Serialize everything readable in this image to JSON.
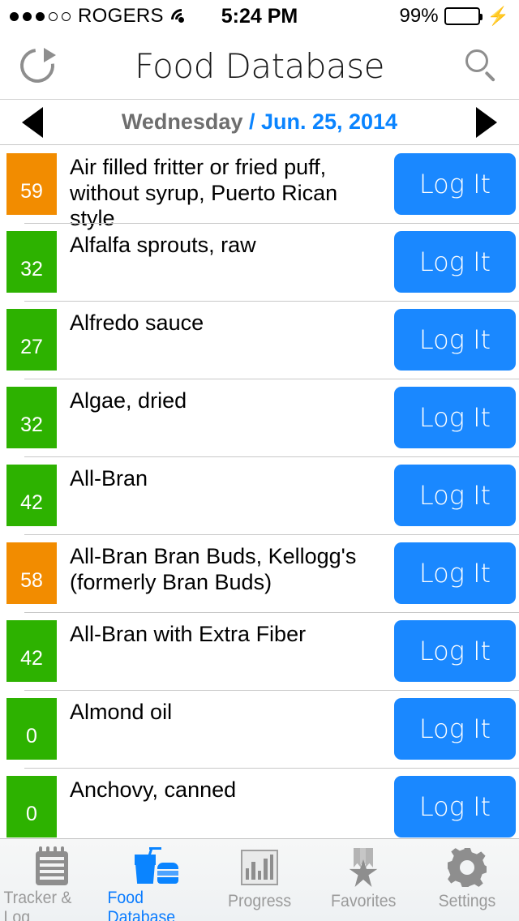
{
  "statusbar": {
    "carrier": "ROGERS",
    "signal_dots_filled": 3,
    "signal_dots_total": 5,
    "wifi_icon": "wifi-icon",
    "time": "5:24 PM",
    "battery_percent": "99%",
    "battery_color": "#4CDA64",
    "charging_icon": "lightning-bolt-icon"
  },
  "navbar": {
    "refresh_icon": "refresh-icon",
    "title": "Food Database",
    "search_icon": "search-icon"
  },
  "datebar": {
    "prev_icon": "triangle-left-icon",
    "next_icon": "triangle-right-icon",
    "day": "Wednesday",
    "date": " / Jun. 25, 2014",
    "day_color": "#6e6e6e",
    "date_color": "#0a84ff"
  },
  "colors": {
    "score_orange": "#F28C00",
    "score_green": "#2DB200",
    "button_blue": "#1A88FF",
    "tab_active": "#0A7CFF",
    "tab_inactive": "#9A9A9A"
  },
  "list": {
    "log_button_label": "Log It",
    "rows": [
      {
        "score": "59",
        "score_color": "orange",
        "name": "Air filled fritter or fried puff, without syrup, Puerto Rican style"
      },
      {
        "score": "32",
        "score_color": "green",
        "name": "Alfalfa sprouts, raw"
      },
      {
        "score": "27",
        "score_color": "green",
        "name": "Alfredo sauce"
      },
      {
        "score": "32",
        "score_color": "green",
        "name": "Algae, dried"
      },
      {
        "score": "42",
        "score_color": "green",
        "name": "All-Bran"
      },
      {
        "score": "58",
        "score_color": "orange",
        "name": "All-Bran Bran Buds, Kellogg's (formerly Bran Buds)"
      },
      {
        "score": "42",
        "score_color": "green",
        "name": "All-Bran with Extra Fiber"
      },
      {
        "score": "0",
        "score_color": "green",
        "name": "Almond oil"
      },
      {
        "score": "0",
        "score_color": "green",
        "name": "Anchovy, canned"
      }
    ]
  },
  "tabbar": {
    "tabs": [
      {
        "label": "Tracker & Log",
        "icon": "notepad-icon",
        "active": false
      },
      {
        "label": "Food Database",
        "icon": "drink-food-icon",
        "active": true
      },
      {
        "label": "Progress",
        "icon": "bar-chart-icon",
        "active": false
      },
      {
        "label": "Favorites",
        "icon": "star-medal-icon",
        "active": false
      },
      {
        "label": "Settings",
        "icon": "gear-icon",
        "active": false
      }
    ]
  }
}
